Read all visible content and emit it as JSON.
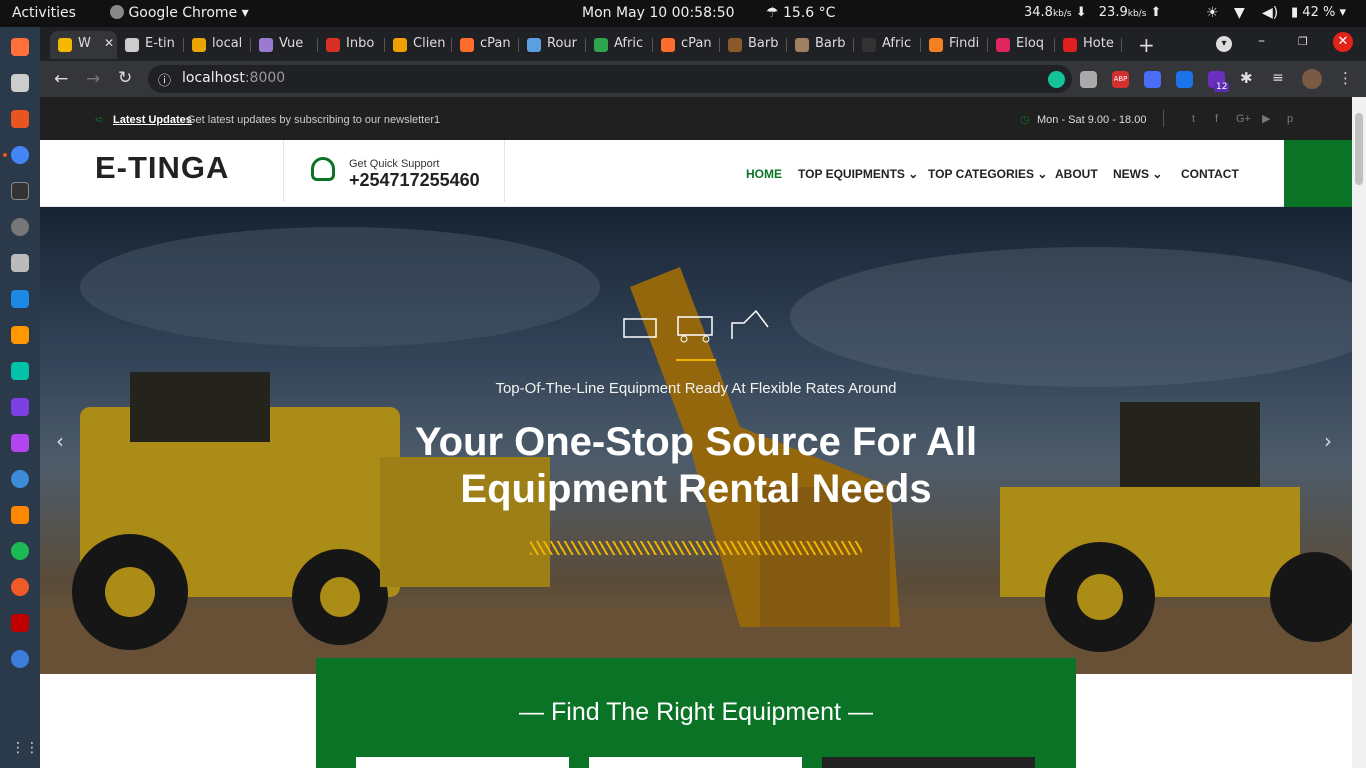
{
  "gnome": {
    "activities": "Activities",
    "app": "Google Chrome",
    "clock": "Mon May 10  00:58:50",
    "weather": "15.6 °C",
    "net_down": "34.8",
    "net_down_unit": "kb/s",
    "net_up": "23.9",
    "net_up_unit": "kb/s",
    "battery": "42 %"
  },
  "tabs": [
    {
      "label": "W",
      "color": "#f5b800",
      "active": true
    },
    {
      "label": "E-tin",
      "color": "#ccc"
    },
    {
      "label": "local",
      "color": "#e9a400"
    },
    {
      "label": "Vue",
      "color": "#9b7bd1"
    },
    {
      "label": "Inbo",
      "color": "#d93025"
    },
    {
      "label": "Clien",
      "color": "#f0a000"
    },
    {
      "label": "cPan",
      "color": "#ff6c2c"
    },
    {
      "label": "Rour",
      "color": "#5aa0e0"
    },
    {
      "label": "Afric",
      "color": "#2da44e"
    },
    {
      "label": "cPan",
      "color": "#ff6c2c"
    },
    {
      "label": "Barb",
      "color": "#8b5a2b"
    },
    {
      "label": "Barb",
      "color": "#a08060"
    },
    {
      "label": "Afric",
      "color": "#333"
    },
    {
      "label": "Findi",
      "color": "#f48024"
    },
    {
      "label": "Eloq",
      "color": "#e0245e"
    },
    {
      "label": "Hote",
      "color": "#e02020"
    }
  ],
  "address": {
    "host": "localhost",
    "port": ":8000"
  },
  "extensions": [
    "grammarly-icon",
    "bookmark-icon",
    "abp-icon",
    "zoom-icon",
    "fi-icon",
    "pf-icon",
    "puzzle-icon",
    "playlist-icon",
    "profile-avatar"
  ],
  "ext_badge": "12",
  "site": {
    "topbar": {
      "latest_label": "Latest Updates",
      "latest_text": "Get latest updates by subscribing to our newsletter1",
      "hours": "Mon - Sat 9.00 - 18.00"
    },
    "logo": "E-TINGA",
    "support_label": "Get Quick Support",
    "support_phone": "+254717255460",
    "nav": [
      "HOME",
      "TOP EQUIPMENTS",
      "TOP CATEGORIES",
      "ABOUT",
      "NEWS",
      "CONTACT"
    ],
    "hero_sub": "Top-Of-The-Line Equipment Ready At Flexible Rates Around",
    "hero_title_1": "Your One-Stop Source For All",
    "hero_title_2": "Equipment Rental Needs",
    "find_title": "Find The Right Equipment"
  },
  "colors": {
    "brand_green": "#0a7326",
    "accent_gold": "#f0b400"
  }
}
